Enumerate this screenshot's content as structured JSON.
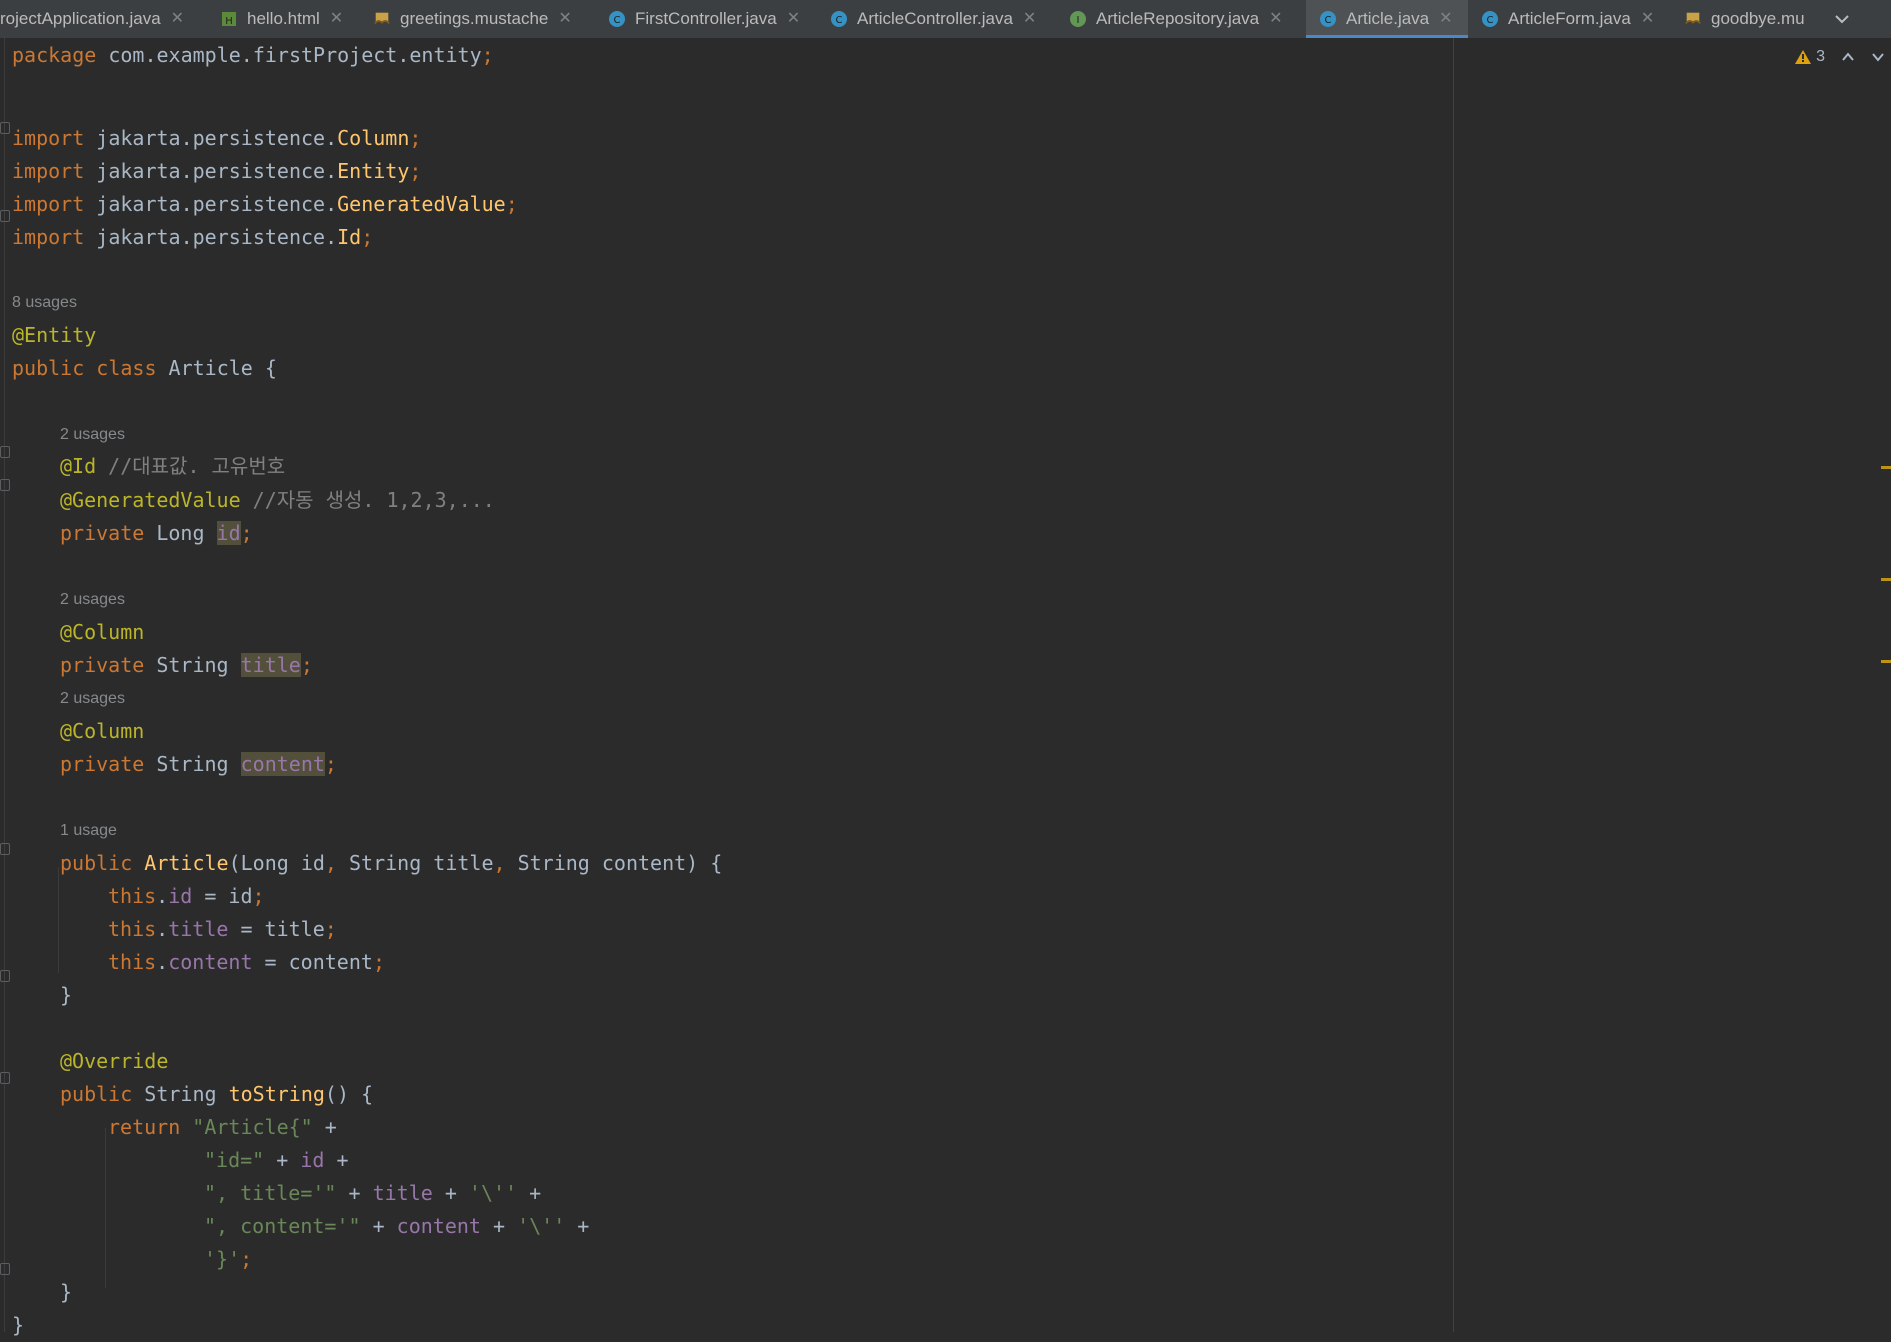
{
  "tabs": [
    {
      "label": "rojectApplication.java",
      "icon": "java-class-icon",
      "active": false
    },
    {
      "label": "hello.html",
      "icon": "html-file-icon",
      "active": false
    },
    {
      "label": "greetings.mustache",
      "icon": "mustache-file-icon",
      "active": false
    },
    {
      "label": "FirstController.java",
      "icon": "java-class-icon",
      "active": false
    },
    {
      "label": "ArticleController.java",
      "icon": "java-class-icon",
      "active": false
    },
    {
      "label": "ArticleRepository.java",
      "icon": "java-interface-icon",
      "active": false
    },
    {
      "label": "Article.java",
      "icon": "java-class-icon",
      "active": true
    },
    {
      "label": "ArticleForm.java",
      "icon": "java-class-icon",
      "active": false
    },
    {
      "label": "goodbye.mu",
      "icon": "mustache-file-icon",
      "active": false
    }
  ],
  "inspections": {
    "warning_count": "3",
    "icon": "warning-triangle-icon"
  },
  "colors": {
    "background": "#2b2b2b",
    "keyword": "#cc7832",
    "annotation": "#bbb529",
    "string": "#6a8759",
    "field": "#9876aa",
    "method": "#ffc66d",
    "comment": "#808080",
    "plain": "#a9b7c6",
    "accent": "#4a88c7",
    "warning": "#be9117"
  },
  "code": {
    "package": [
      "package",
      " com.example.firstProject.entity",
      ";"
    ],
    "import1": [
      "import",
      " jakarta.persistence.",
      "Column",
      ";"
    ],
    "import2": [
      "import",
      " jakarta.persistence.",
      "Entity",
      ";"
    ],
    "import3": [
      "import",
      " jakarta.persistence.",
      "GeneratedValue",
      ";"
    ],
    "import4": [
      "import",
      " jakarta.persistence.",
      "Id",
      ";"
    ],
    "hint_class": "8 usages",
    "ann_entity": "@Entity",
    "class_decl": [
      "public class",
      " Article {"
    ],
    "hint_id": "2 usages",
    "ann_id": [
      "@Id",
      " //대표값. 고유번호"
    ],
    "ann_gen": [
      "@GeneratedValue",
      " //자동 생성. 1,2,3,..."
    ],
    "field_id": [
      "private",
      " Long ",
      "id",
      ";"
    ],
    "hint_title": "2 usages",
    "ann_col1": "@Column",
    "field_title": [
      "private",
      " String ",
      "title",
      ";"
    ],
    "hint_content": "2 usages",
    "ann_col2": "@Column",
    "field_content": [
      "private",
      " String ",
      "content",
      ";"
    ],
    "hint_ctor": "1 usage",
    "ctor": [
      "public",
      " ",
      "Article",
      "(Long id",
      ",",
      " String title",
      ",",
      " String content) {"
    ],
    "assign_id": [
      "this",
      ".",
      "id",
      " = id",
      ";"
    ],
    "assign_title": [
      "this",
      ".",
      "title",
      " = title",
      ";"
    ],
    "assign_content": [
      "this",
      ".",
      "content",
      " = content",
      ";"
    ],
    "close_brace1": "}",
    "ann_override": "@Override",
    "tostring": [
      "public",
      " String ",
      "toString",
      "() {"
    ],
    "ret1": [
      "return",
      " ",
      "\"Article{\"",
      " +"
    ],
    "ret2": [
      "\"id=\"",
      " + ",
      "id",
      " +"
    ],
    "ret3": [
      "\", title='\"",
      " + ",
      "title",
      " + ",
      "'\\''",
      " +"
    ],
    "ret4": [
      "\", content='\"",
      " + ",
      "content",
      " + ",
      "'\\''",
      " +"
    ],
    "ret5": [
      "'}'",
      ";"
    ],
    "close_brace2": "}",
    "close_brace3": "}"
  }
}
